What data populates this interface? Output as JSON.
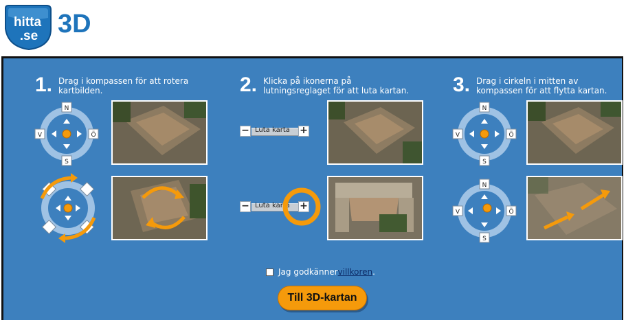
{
  "header": {
    "logo_line1": "hitta",
    "logo_line2": ".se",
    "title": "3D"
  },
  "steps": [
    {
      "number": "1.",
      "text_line1": "Drag i kompassen för att rotera",
      "text_line2": "kartbilden."
    },
    {
      "number": "2.",
      "text_line1": "Klicka på ikonerna på",
      "text_line2": "lutningsreglaget för att luta kartan."
    },
    {
      "number": "3.",
      "text_line1": "Drag i cirkeln i mitten av",
      "text_line2": "kompassen för att flytta kartan."
    }
  ],
  "compass": {
    "north": "N",
    "south": "S",
    "west": "V",
    "east": "Ö"
  },
  "tilt_slider": {
    "label": "Luta karta",
    "minus": "−",
    "plus": "+"
  },
  "terms": {
    "text": "Jag godkänner ",
    "link": "villkoren",
    "suffix": ".",
    "checked": false
  },
  "cta": {
    "label": "Till 3D-kartan"
  },
  "colors": {
    "panel": "#3d80be",
    "accent": "#f59a0b",
    "logo_blue": "#1e74bb"
  }
}
